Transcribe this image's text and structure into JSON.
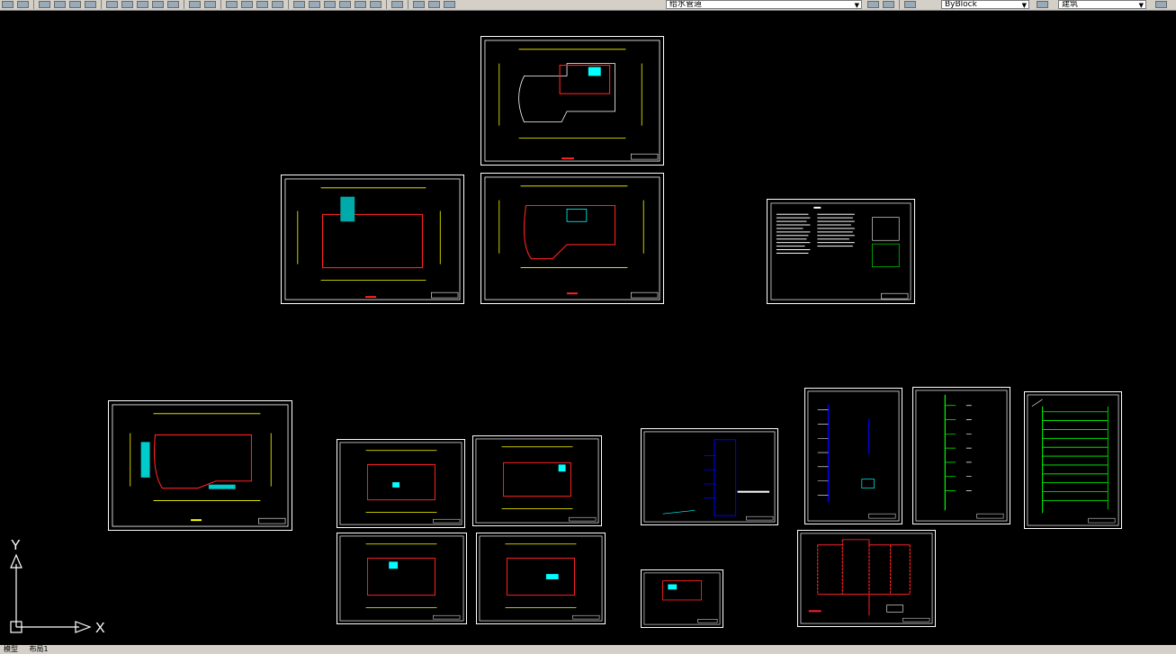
{
  "toolbar": {
    "layer_value": "给水管道",
    "linetype_value": "ByBlock",
    "style_value": "建筑"
  },
  "ucs": {
    "x_label": "X",
    "y_label": "Y"
  },
  "status": {
    "model_tab": "模型",
    "layout_tab": "布局1"
  },
  "colors": {
    "background": "#000000",
    "frame": "#ffffff",
    "dimension": "#ffff00",
    "wall": "#ff2020",
    "fixture": "#00ffff",
    "riser": "#0000ff",
    "pipe": "#00ff00"
  }
}
